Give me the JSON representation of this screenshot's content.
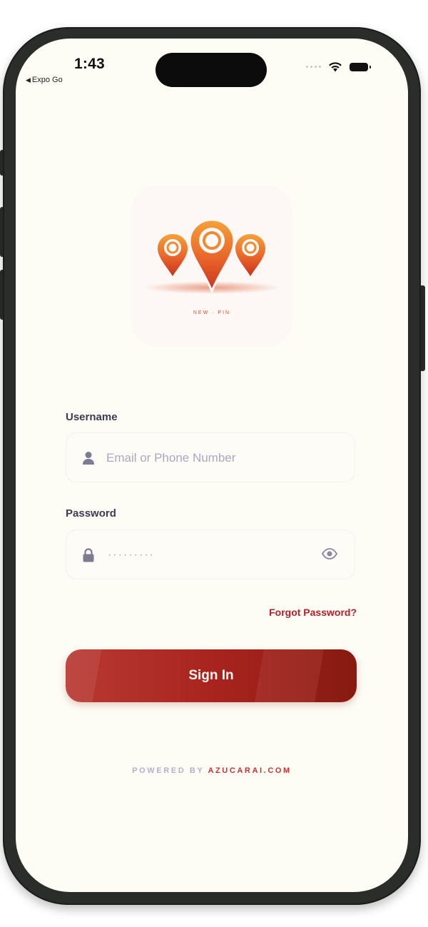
{
  "status_bar": {
    "time": "1:43",
    "back_app": "Expo Go"
  },
  "logo": {
    "caption": "NEW · PIN"
  },
  "form": {
    "username_label": "Username",
    "username_placeholder": "Email or Phone Number",
    "password_label": "Password",
    "password_value": "·········",
    "forgot_label": "Forgot Password?",
    "signin_label": "Sign In"
  },
  "footer": {
    "powered_prefix": "POWERED BY ",
    "powered_brand": "AZUCARAI.COM"
  },
  "colors": {
    "accent": "#b3222c",
    "button_start": "#b93a33",
    "button_end": "#8e1b12",
    "background": "#fdfcf5",
    "label": "#3d3b52",
    "placeholder": "#a9a8bf"
  }
}
